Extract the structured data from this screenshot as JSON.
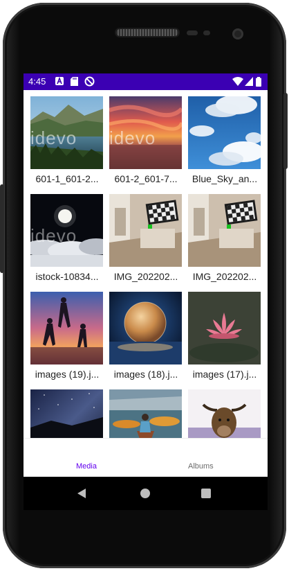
{
  "status": {
    "time": "4:45"
  },
  "grid": {
    "items": [
      {
        "caption": "601-1_601-2..."
      },
      {
        "caption": "601-2_601-7..."
      },
      {
        "caption": "Blue_Sky_an..."
      },
      {
        "caption": "istock-10834..."
      },
      {
        "caption": "IMG_202202..."
      },
      {
        "caption": "IMG_202202..."
      },
      {
        "caption": "images (19).j..."
      },
      {
        "caption": "images (18).j..."
      },
      {
        "caption": "images (17).j..."
      },
      {
        "caption": ""
      },
      {
        "caption": ""
      },
      {
        "caption": ""
      }
    ]
  },
  "tabs": {
    "media": "Media",
    "albums": "Albums"
  },
  "colors": {
    "status_bar": "#3b00b3",
    "accent": "#6200ee"
  },
  "watermark": {
    "text": "idevo"
  }
}
